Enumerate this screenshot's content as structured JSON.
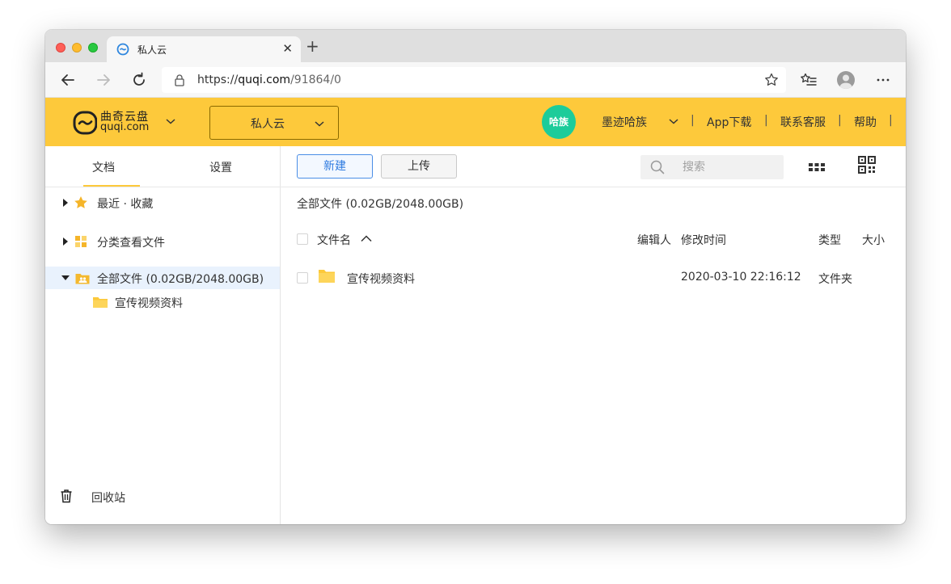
{
  "browser": {
    "tab_title": "私人云",
    "url_scheme": "https://",
    "url_host": "quqi.com",
    "url_path": "/91864/0"
  },
  "header": {
    "logo_title": "曲奇云盘",
    "logo_sub": "quqi.com",
    "space_label": "私人云",
    "org_badge": "哈族",
    "org_name": "墨迹哈族",
    "links": [
      "App下载",
      "联系客服",
      "帮助"
    ],
    "brand_color": "#fdc93b"
  },
  "sidebar": {
    "tabs": [
      "文档",
      "设置"
    ],
    "tree": [
      {
        "label": "最近 · 收藏"
      },
      {
        "label": "分类查看文件"
      },
      {
        "label": "全部文件 (0.02GB/2048.00GB)"
      },
      {
        "label": "宣传视频资料"
      }
    ],
    "trash_label": "回收站"
  },
  "toolbar": {
    "new_label": "新建",
    "upload_label": "上传",
    "search_placeholder": "搜索"
  },
  "main": {
    "breadcrumb": "全部文件 (0.02GB/2048.00GB)",
    "columns": [
      "文件名",
      "编辑人",
      "修改时间",
      "类型",
      "大小"
    ],
    "rows": [
      {
        "name": "宣传视频资料",
        "editor": "",
        "modified": "2020-03-10 22:16:12",
        "type": "文件夹",
        "size": ""
      }
    ]
  }
}
